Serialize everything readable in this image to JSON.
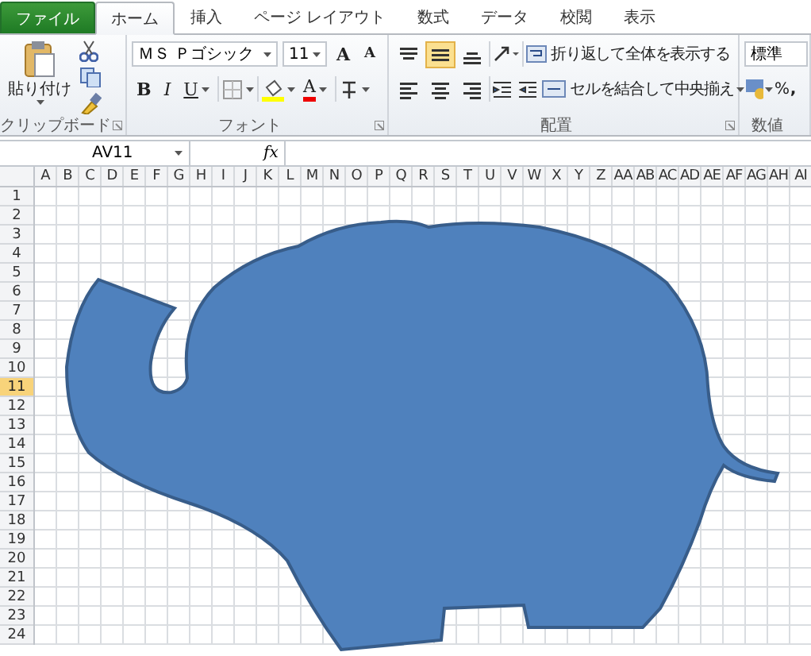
{
  "tabs": [
    {
      "label": "ファイル",
      "kind": "file",
      "selected": false
    },
    {
      "label": "ホーム",
      "kind": "tab",
      "selected": true
    },
    {
      "label": "挿入",
      "kind": "tab",
      "selected": false
    },
    {
      "label": "ページ レイアウト",
      "kind": "tab",
      "selected": false
    },
    {
      "label": "数式",
      "kind": "tab",
      "selected": false
    },
    {
      "label": "データ",
      "kind": "tab",
      "selected": false
    },
    {
      "label": "校閲",
      "kind": "tab",
      "selected": false
    },
    {
      "label": "表示",
      "kind": "tab",
      "selected": false
    }
  ],
  "ribbon": {
    "clipboard": {
      "paste": "貼り付け",
      "label": "クリップボード"
    },
    "font": {
      "font_name": "ＭＳ Ｐゴシック",
      "font_size": "11",
      "grow": "A",
      "shrink": "A",
      "bold": "B",
      "italic": "I",
      "underline": "U",
      "font_color": "A",
      "label": "フォント"
    },
    "alignment": {
      "vertical_align": [
        {
          "kind": "top",
          "selected": false
        },
        {
          "kind": "middle",
          "selected": true
        },
        {
          "kind": "bottom",
          "selected": false
        }
      ],
      "horizontal_align": [
        {
          "kind": "left",
          "selected": false
        },
        {
          "kind": "center",
          "selected": false
        },
        {
          "kind": "right",
          "selected": false
        }
      ],
      "wrap_text": "折り返して全体を表示する",
      "merge_center": "セルを結合して中央揃え",
      "label": "配置"
    },
    "number": {
      "format": "標準",
      "percent": "%",
      "comma": ",",
      "label": "数値"
    }
  },
  "formula_bar": {
    "name_box": "AV11",
    "function_button": "fx"
  },
  "sheet": {
    "columns": [
      "A",
      "B",
      "C",
      "D",
      "E",
      "F",
      "G",
      "H",
      "I",
      "J",
      "K",
      "L",
      "M",
      "N",
      "O",
      "P",
      "Q",
      "R",
      "S",
      "T",
      "U",
      "V",
      "W",
      "X",
      "Y",
      "Z",
      "AA",
      "AB",
      "AC",
      "AD",
      "AE",
      "AF",
      "AG",
      "AH",
      "AI"
    ],
    "rows": [
      {
        "label": "1",
        "selected": false
      },
      {
        "label": "2",
        "selected": false
      },
      {
        "label": "3",
        "selected": false
      },
      {
        "label": "4",
        "selected": false
      },
      {
        "label": "5",
        "selected": false
      },
      {
        "label": "6",
        "selected": false
      },
      {
        "label": "7",
        "selected": false
      },
      {
        "label": "8",
        "selected": false
      },
      {
        "label": "9",
        "selected": false
      },
      {
        "label": "10",
        "selected": false
      },
      {
        "label": "11",
        "selected": true
      },
      {
        "label": "12",
        "selected": false
      },
      {
        "label": "13",
        "selected": false
      },
      {
        "label": "14",
        "selected": false
      },
      {
        "label": "15",
        "selected": false
      },
      {
        "label": "16",
        "selected": false
      },
      {
        "label": "17",
        "selected": false
      },
      {
        "label": "18",
        "selected": false
      },
      {
        "label": "19",
        "selected": false
      },
      {
        "label": "20",
        "selected": false
      },
      {
        "label": "21",
        "selected": false
      },
      {
        "label": "22",
        "selected": false
      },
      {
        "label": "23",
        "selected": false
      },
      {
        "label": "24",
        "selected": false
      }
    ],
    "shape": {
      "kind": "elephant"
    }
  }
}
